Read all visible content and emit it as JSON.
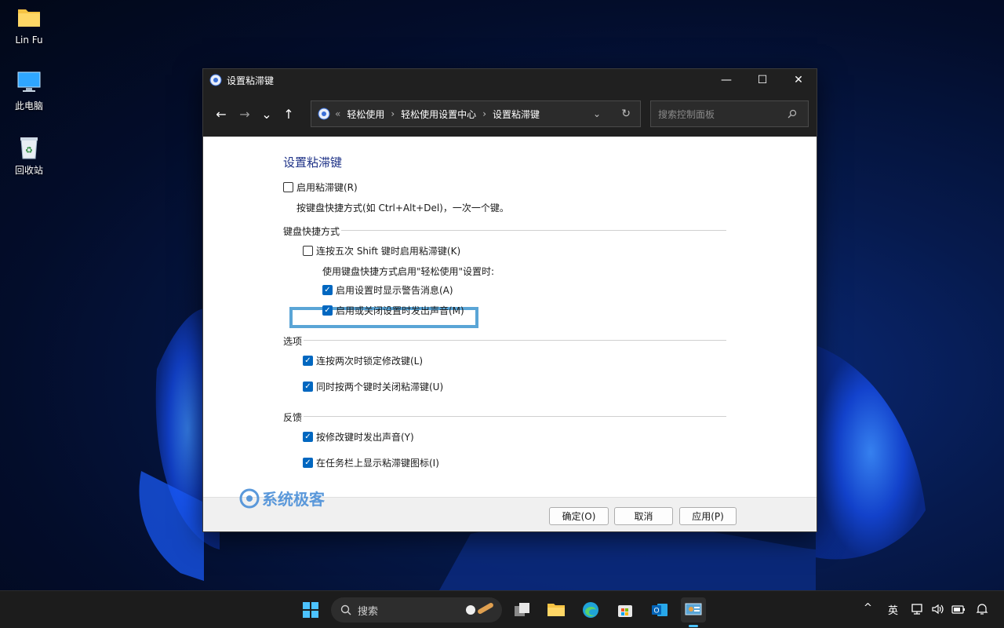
{
  "desktop": {
    "icons": [
      {
        "label": "Lin Fu"
      },
      {
        "label": "此电脑"
      },
      {
        "label": "回收站"
      }
    ]
  },
  "window": {
    "title": "设置粘滞键",
    "controls": {
      "minimize": "—",
      "maximize": "☐",
      "close": "✕"
    },
    "nav": {
      "back": "←",
      "forward": "→",
      "recent": "⌄",
      "up": "↑"
    },
    "address": {
      "prefix": "«",
      "crumbs": [
        "轻松使用",
        "轻松使用设置中心",
        "设置粘滞键"
      ],
      "separator": "›",
      "dropdown": "⌄",
      "refresh": "↻"
    },
    "search": {
      "placeholder": "搜索控制面板"
    },
    "content": {
      "heading": "设置粘滞键",
      "enable_sticky": {
        "label": "启用粘滞键(R)",
        "checked": false
      },
      "enable_desc": "按键盘快捷方式(如 Ctrl+Alt+Del)，一次一个键。",
      "shortcut_section": "键盘快捷方式",
      "shift_five": {
        "label": "连按五次 Shift 键时启用粘滞键(K)",
        "checked": false
      },
      "shortcut_desc": "使用键盘快捷方式启用\"轻松使用\"设置时:",
      "show_warning": {
        "label": "启用设置时显示警告消息(A)",
        "checked": true
      },
      "play_sound": {
        "label": "启用或关闭设置时发出声音(M)",
        "checked": true
      },
      "options_section": "选项",
      "lock_modifier": {
        "label": "连按两次时锁定修改键(L)",
        "checked": true
      },
      "turn_off_two": {
        "label": "同时按两个键时关闭粘滞键(U)",
        "checked": true
      },
      "feedback_section": "反馈",
      "sound_modifier": {
        "label": "按修改键时发出声音(Y)",
        "checked": true
      },
      "show_taskbar_icon": {
        "label": "在任务栏上显示粘滞键图标(I)",
        "checked": true
      }
    },
    "footer": {
      "ok": "确定(O)",
      "cancel": "取消",
      "apply": "应用(P)"
    }
  },
  "watermark": {
    "text": "系统极客"
  },
  "taskbar": {
    "search_label": "搜索",
    "tray": {
      "ime": "英",
      "chevron": "^"
    }
  },
  "colors": {
    "accent": "#0067c0",
    "highlight": "#5aa5d6",
    "heading": "#1e3287"
  }
}
